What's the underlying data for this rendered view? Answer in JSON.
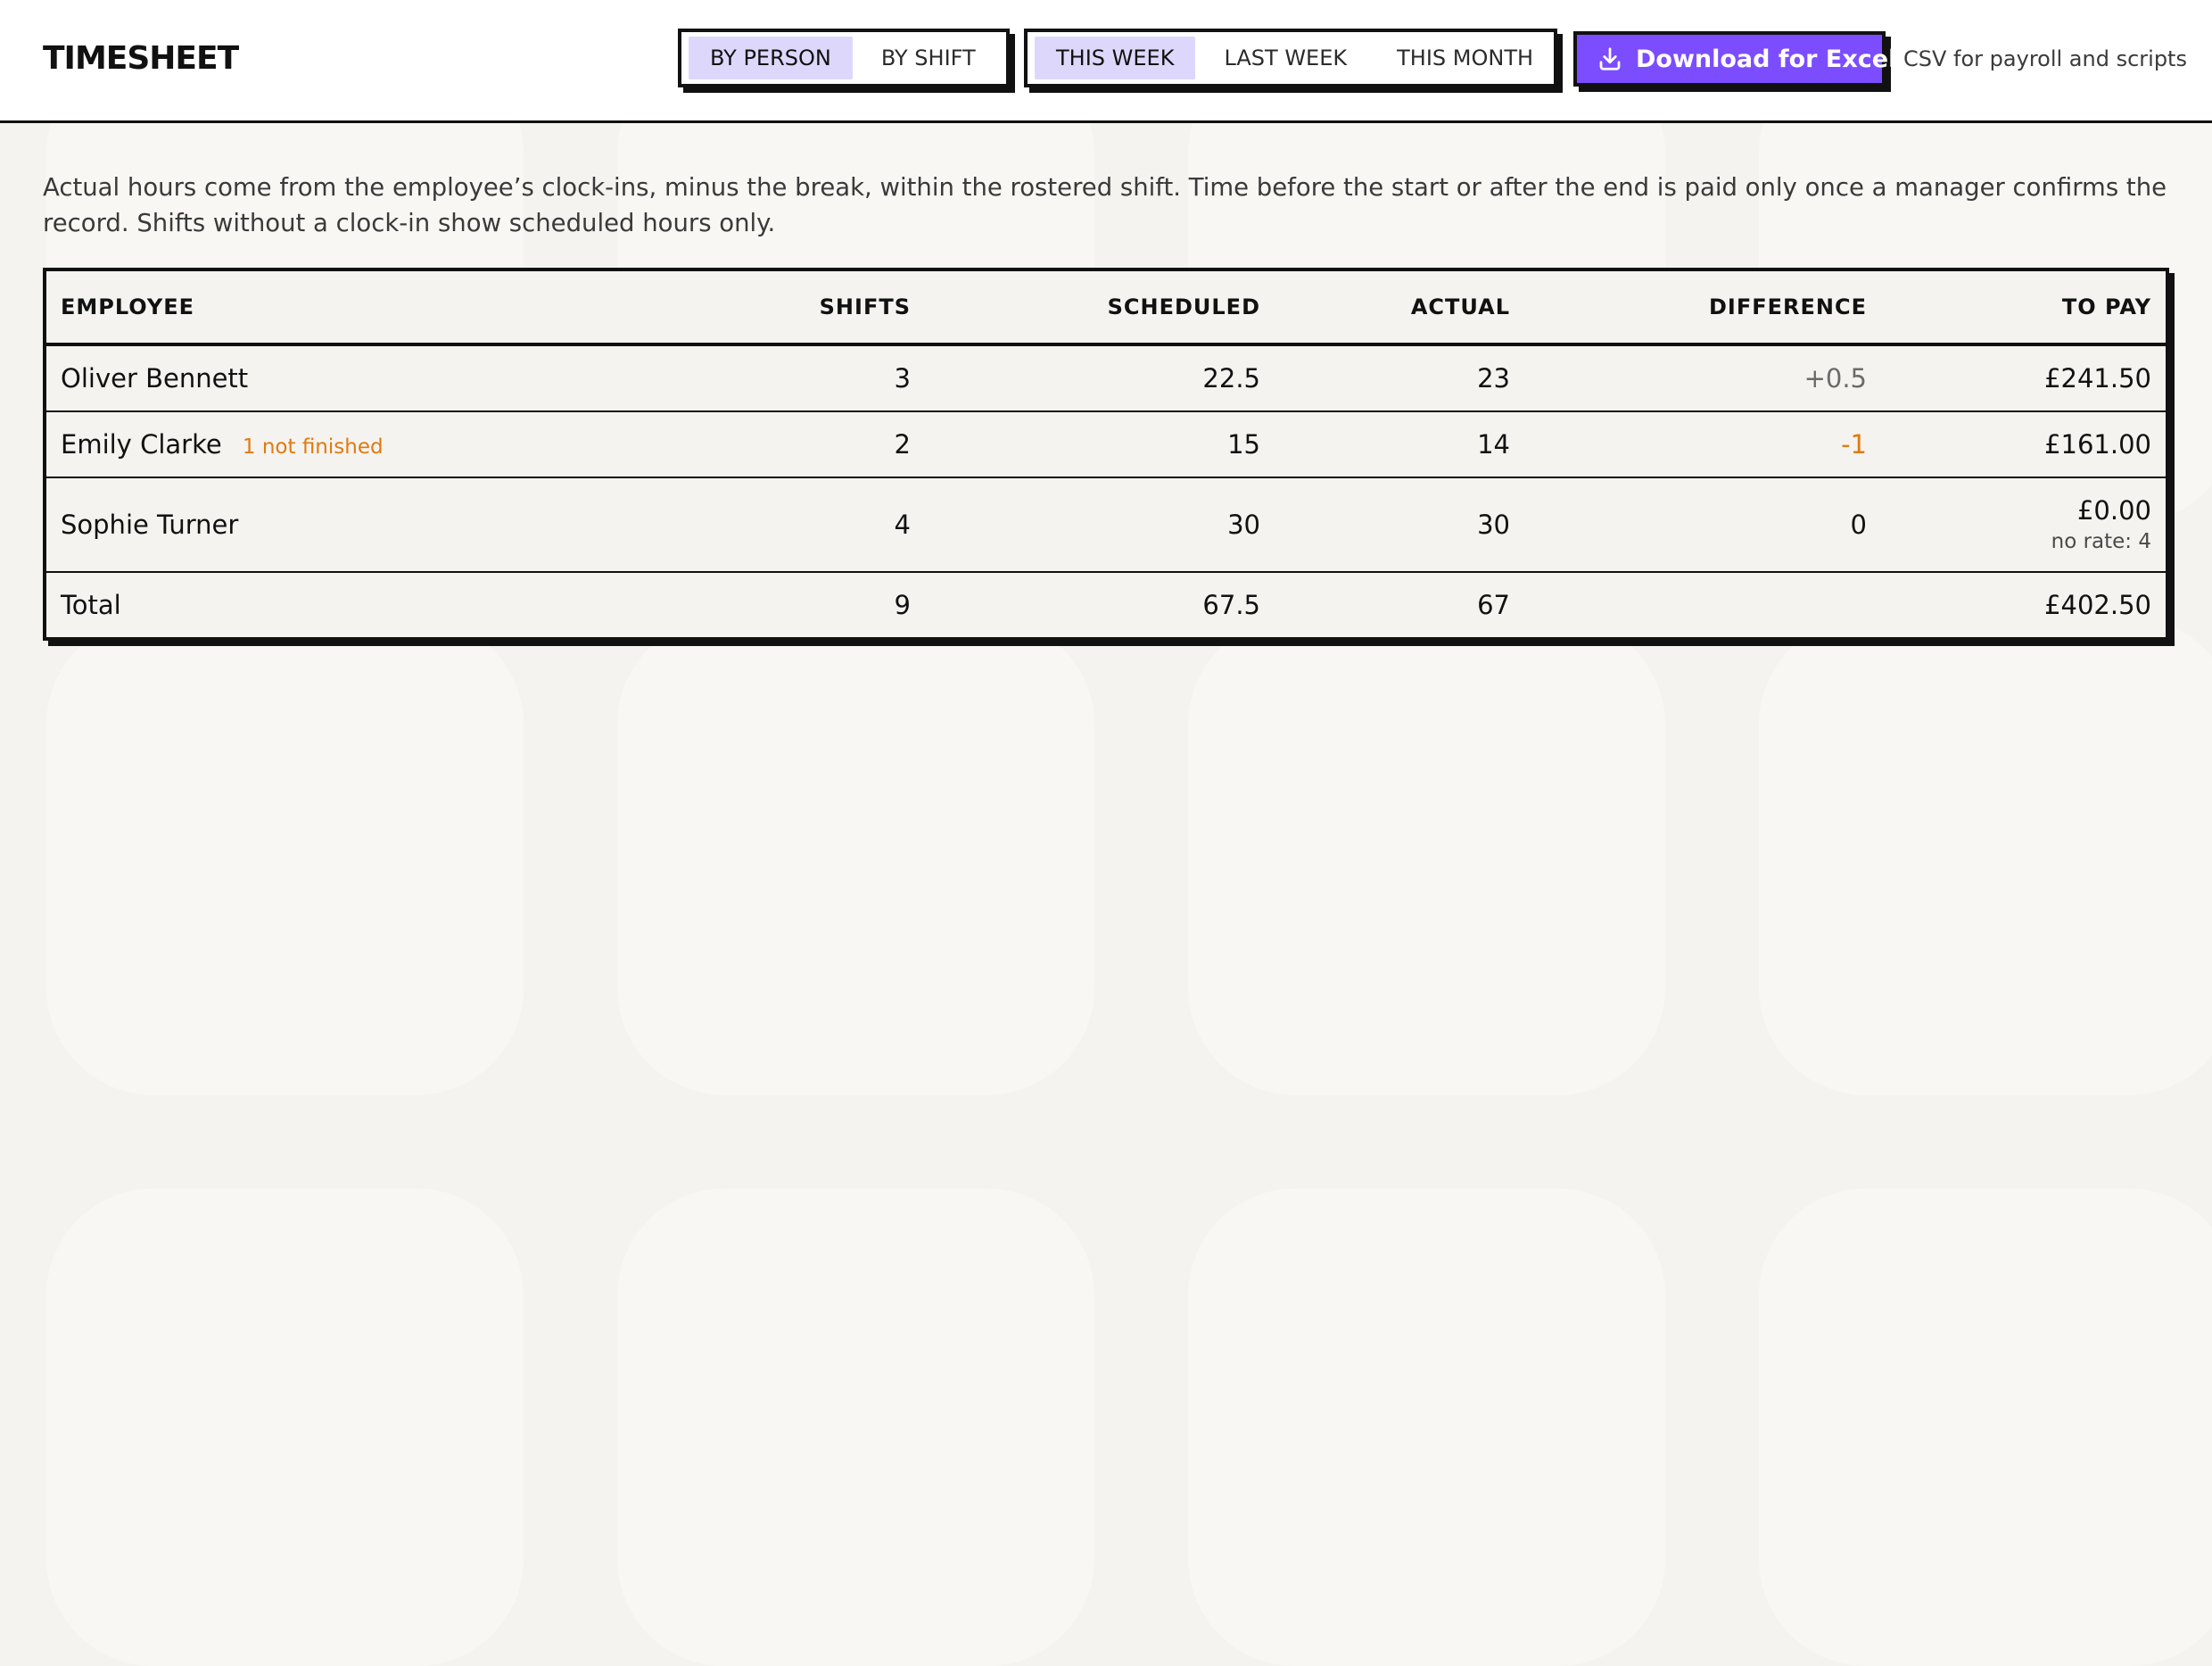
{
  "header": {
    "title": "TIMESHEET",
    "view_toggle": [
      "BY PERSON",
      "BY SHIFT"
    ],
    "view_selected": "BY PERSON",
    "period_toggle": [
      "THIS WEEK",
      "LAST WEEK",
      "THIS MONTH"
    ],
    "period_selected": "THIS WEEK",
    "download_label": "Download for Excel",
    "download_icon": "download-icon",
    "download_hint": "CSV for payroll and scripts"
  },
  "intro": "Actual hours come from the employee’s clock-ins, minus the break, within the rostered shift. Time before the start or after the end is paid only once a manager confirms the record. Shifts without a clock-in show scheduled hours only.",
  "table": {
    "columns": [
      "EMPLOYEE",
      "SHIFTS",
      "SCHEDULED",
      "ACTUAL",
      "DIFFERENCE",
      "TO PAY"
    ],
    "rows": [
      {
        "employee": "Oliver Bennett",
        "badge": "",
        "shifts": "3",
        "scheduled": "22.5",
        "actual": "23",
        "difference": "+0.5",
        "to_pay": "£241.50",
        "pay_note": ""
      },
      {
        "employee": "Emily Clarke",
        "badge": "1 not finished",
        "shifts": "2",
        "scheduled": "15",
        "actual": "14",
        "difference": "-1",
        "to_pay": "£161.00",
        "pay_note": ""
      },
      {
        "employee": "Sophie Turner",
        "badge": "",
        "shifts": "4",
        "scheduled": "30",
        "actual": "30",
        "difference": "0",
        "to_pay": "£0.00",
        "pay_note": "no rate: 4"
      }
    ],
    "total": {
      "label": "Total",
      "shifts": "9",
      "scheduled": "67.5",
      "actual": "67",
      "difference": "",
      "to_pay": "£402.50"
    }
  },
  "colors": {
    "accent": "#7c4dff",
    "selected_bg": "#ddd8fb",
    "warning": "#e07a10",
    "border": "#111111",
    "background": "#f4f3f0"
  }
}
